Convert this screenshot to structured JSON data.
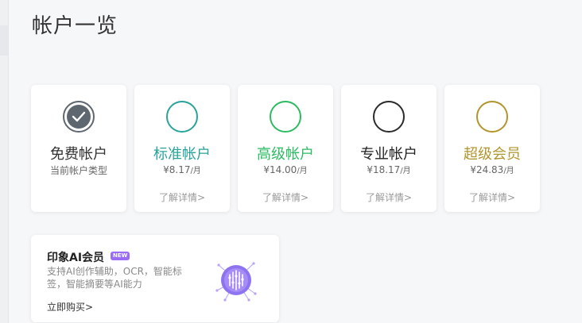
{
  "page": {
    "title": "帐户一览"
  },
  "plans": [
    {
      "name": "免费帐户",
      "subtitle": "当前帐户类型",
      "more": "",
      "color": "#333333",
      "ring_color": "#5e6770",
      "current": true
    },
    {
      "name": "标准帐户",
      "price": "¥8.17",
      "unit": "/月",
      "more": "了解详情>",
      "color": "#2ba39b",
      "ring_color": "#2ba39b"
    },
    {
      "name": "高级帐户",
      "price": "¥14.00",
      "unit": "/月",
      "more": "了解详情>",
      "color": "#2dbb62",
      "ring_color": "#2dbb62"
    },
    {
      "name": "专业帐户",
      "price": "¥18.17",
      "unit": "/月",
      "more": "了解详情>",
      "color": "#222222",
      "ring_color": "#2b2b2b"
    },
    {
      "name": "超级会员",
      "price": "¥24.83",
      "unit": "/月",
      "more": "了解详情>",
      "color": "#b0952d",
      "ring_color": "#b0952d"
    }
  ],
  "ai": {
    "title": "印象AI会员",
    "badge": "NEW",
    "description": "支持AI创作辅助，OCR，智能标签，智能摘要等AI能力",
    "buy_label": "立即购买>",
    "icon": "ai-chip-icon",
    "accent": "#9b6cf6"
  },
  "icons": {
    "current_plan": "checkmark-icon"
  }
}
